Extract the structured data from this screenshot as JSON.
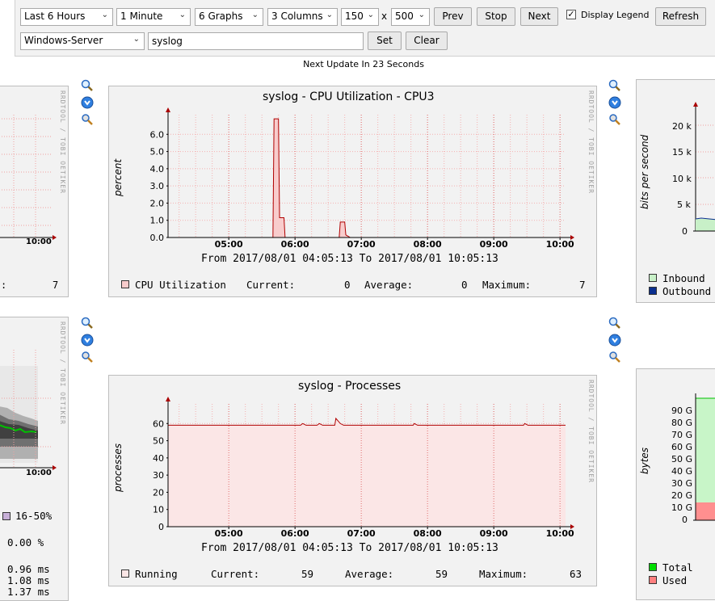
{
  "toolbar": {
    "timespan": "Last 6 Hours",
    "interval": "1 Minute",
    "graphs": "6 Graphs",
    "columns": "3 Columns",
    "height": "150",
    "x": "x",
    "width": "500",
    "prev": "Prev",
    "stop": "Stop",
    "next": "Next",
    "display_legend": "Display Legend",
    "display_legend_checked": true,
    "refresh": "Refresh",
    "host": "Windows-Server",
    "filter": "syslog",
    "set": "Set",
    "clear": "Clear"
  },
  "next_update": "Next Update In 23 Seconds",
  "rrd_credit": "RRDTOOL / TOBI OETIKER",
  "graph_cpu": {
    "title": "syslog - CPU Utilization - CPU3",
    "ylabel": "percent",
    "range": "From 2017/08/01 04:05:13 To 2017/08/01 10:05:13",
    "legend_name": "CPU Utilization",
    "current_label": "Current:",
    "current": "0",
    "average_label": "Average:",
    "average": "0",
    "maximum_label": "Maximum:",
    "maximum": "7",
    "color": "#f8cccc"
  },
  "graph_proc": {
    "title": "syslog - Processes",
    "ylabel": "processes",
    "range": "From 2017/08/01 04:05:13 To 2017/08/01 10:05:13",
    "legend_name": "Running",
    "current_label": "Current:",
    "current": "59",
    "average_label": "Average:",
    "average": "59",
    "maximum_label": "Maximum:",
    "maximum": "63",
    "color": "#fbe6e6"
  },
  "graph_left_top": {
    "xtick": "10:00",
    "legend_value": "7",
    "legend_colon": ":"
  },
  "graph_left_bottom": {
    "xtick": "10:00",
    "legend_range": "16-50%",
    "pct": "0.00 %",
    "ms1": "0.96 ms",
    "ms2": "1.08 ms",
    "ms3": "1.37 ms"
  },
  "graph_right_top": {
    "ylabel": "bits per second",
    "yticks": [
      "20 k",
      "15 k",
      "10 k",
      "5 k",
      "0"
    ],
    "legend_inbound": "Inbound",
    "legend_outbound": "Outbound",
    "inbound_color": "#c8f0c8",
    "outbound_color": "#0b2f8f"
  },
  "graph_right_bottom": {
    "ylabel": "bytes",
    "yticks": [
      "90 G",
      "80 G",
      "70 G",
      "60 G",
      "50 G",
      "40 G",
      "30 G",
      "20 G",
      "10 G",
      "0"
    ],
    "legend_total": "Total",
    "legend_used": "Used",
    "total_color": "#00dd00",
    "used_color": "#ff7f7f"
  },
  "chart_data": [
    {
      "type": "area",
      "title": "syslog - CPU Utilization - CPU3",
      "ylabel": "percent",
      "x_ticks": [
        "05:00",
        "06:00",
        "07:00",
        "08:00",
        "09:00",
        "10:00"
      ],
      "y_ticks": [
        "0.0",
        "1.0",
        "2.0",
        "3.0",
        "4.0",
        "5.0",
        "6.0"
      ],
      "ylim": [
        0,
        7
      ],
      "series": [
        {
          "name": "CPU Utilization",
          "points": [
            [
              "04:05",
              0
            ],
            [
              "05:40",
              0
            ],
            [
              "05:41",
              6.9
            ],
            [
              "05:45",
              6.9
            ],
            [
              "05:46",
              1.15
            ],
            [
              "05:50",
              1.15
            ],
            [
              "05:51",
              0
            ],
            [
              "06:40",
              0
            ],
            [
              "06:41",
              0.9
            ],
            [
              "06:45",
              0.9
            ],
            [
              "06:46",
              0.15
            ],
            [
              "06:50",
              0
            ],
            [
              "10:05",
              0
            ]
          ]
        }
      ]
    },
    {
      "type": "area",
      "title": "syslog - Processes",
      "ylabel": "processes",
      "x_ticks": [
        "05:00",
        "06:00",
        "07:00",
        "08:00",
        "09:00",
        "10:00"
      ],
      "y_ticks": [
        "0",
        "10",
        "20",
        "30",
        "40",
        "50",
        "60"
      ],
      "ylim": [
        0,
        70
      ],
      "series": [
        {
          "name": "Running",
          "points": [
            [
              "04:05",
              59
            ],
            [
              "06:05",
              59
            ],
            [
              "06:07",
              60
            ],
            [
              "06:10",
              59
            ],
            [
              "06:20",
              59
            ],
            [
              "06:22",
              60
            ],
            [
              "06:25",
              59
            ],
            [
              "06:36",
              59
            ],
            [
              "06:37",
              63
            ],
            [
              "06:41",
              60
            ],
            [
              "06:44",
              59
            ],
            [
              "07:47",
              59
            ],
            [
              "07:48",
              60
            ],
            [
              "07:51",
              59
            ],
            [
              "09:27",
              59
            ],
            [
              "09:28",
              60
            ],
            [
              "09:31",
              59
            ],
            [
              "10:05",
              59
            ]
          ]
        }
      ]
    }
  ]
}
